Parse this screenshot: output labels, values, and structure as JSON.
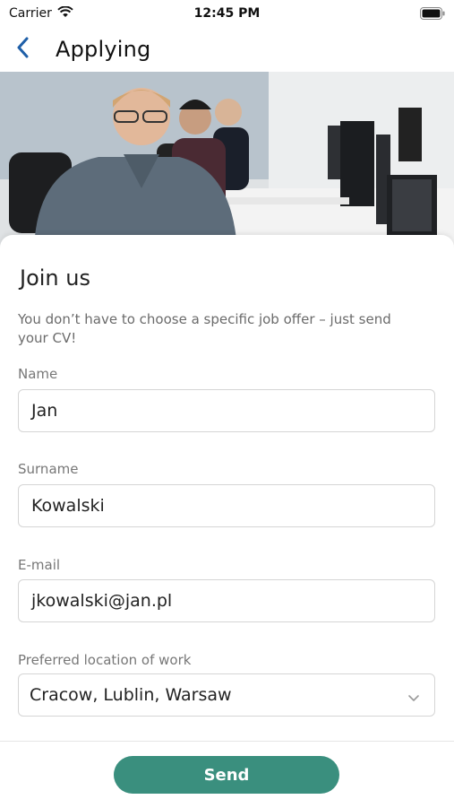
{
  "status_bar": {
    "carrier": "Carrier",
    "time": "12:45 PM"
  },
  "nav": {
    "title": "Applying"
  },
  "form": {
    "heading": "Join us",
    "intro": "You don’t have to choose a specific job offer – just send your CV!",
    "fields": {
      "name": {
        "label": "Name",
        "value": "Jan"
      },
      "surname": {
        "label": "Surname",
        "value": "Kowalski"
      },
      "email": {
        "label": "E-mail",
        "value": "jkowalski@jan.pl"
      },
      "location": {
        "label": "Preferred location of work",
        "value": "Cracow, Lublin, Warsaw"
      }
    }
  },
  "actions": {
    "send_label": "Send"
  },
  "colors": {
    "accent": "#3a8f7e",
    "back_arrow": "#1f5fa8"
  }
}
